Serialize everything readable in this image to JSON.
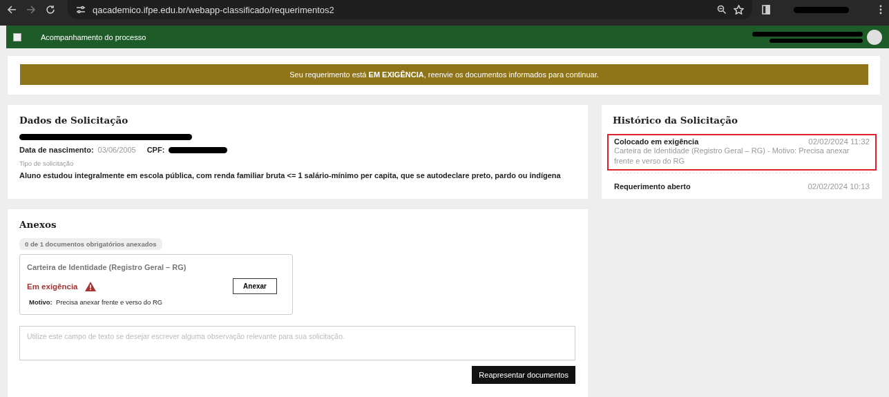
{
  "browser": {
    "url": "qacademico.ifpe.edu.br/webapp-classificado/requerimentos2"
  },
  "header": {
    "title": "Acompanhamento do processo"
  },
  "banner": {
    "text": "Seu requerimento está **EM EXIGÊNCIA**, reenvie os documentos informados para continuar."
  },
  "dados": {
    "title": "Dados de Solicitação",
    "birth_label": "Data de nascimento:",
    "birth_value": "03/06/2005",
    "cpf_label": "CPF:",
    "type_label": "Tipo de solicitação",
    "type_value": "Aluno estudou integralmente em escola pública, com renda familiar bruta <= 1 salário-mínimo per capita, que se autodeclare preto, pardo ou indígena"
  },
  "historico": {
    "title": "Histórico da Solicitação",
    "items": [
      {
        "title": "Colocado em exigência",
        "time": "02/02/2024 11:32",
        "detail": "Carteira de Identidade (Registro Geral – RG) - Motivo: Precisa anexar frente e verso do RG",
        "highlighted": true
      },
      {
        "title": "Requerimento aberto",
        "time": "02/02/2024 10:13",
        "highlighted": false
      }
    ]
  },
  "anexos": {
    "title": "Anexos",
    "count_badge": "0 de 1 documentos obrigatórios anexados",
    "documents": [
      {
        "name": "Carteira de Identidade (Registro Geral – RG)",
        "status": "Em exigência",
        "warning": true,
        "button": "Anexar",
        "reason_label": "Motivo:",
        "reason": "Precisa anexar frente e verso do RG"
      }
    ],
    "notes": {
      "placeholder": "Utilize este campo de texto se desejar escrever alguma observação relevante para sua solicitação."
    },
    "submit": "Reapresentar documentos"
  }
}
